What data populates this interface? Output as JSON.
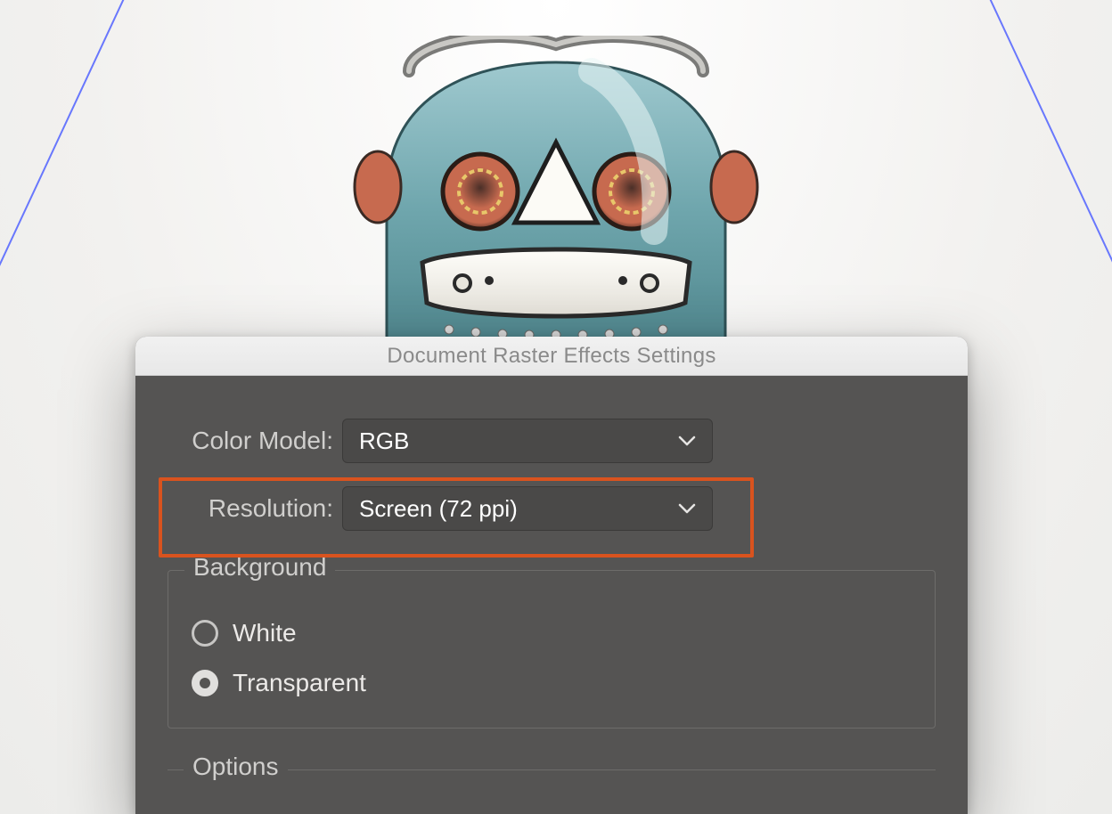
{
  "dialog": {
    "title": "Document Raster Effects Settings",
    "color_model": {
      "label": "Color Model:",
      "value": "RGB"
    },
    "resolution": {
      "label": "Resolution:",
      "value": "Screen (72 ppi)"
    },
    "background": {
      "legend": "Background",
      "options": {
        "white": "White",
        "transparent": "Transparent"
      },
      "selected": "transparent"
    },
    "options": {
      "legend": "Options"
    }
  },
  "colors": {
    "highlight": "#d9531e",
    "dialog_bg": "#555453",
    "guide": "#5061ff"
  }
}
